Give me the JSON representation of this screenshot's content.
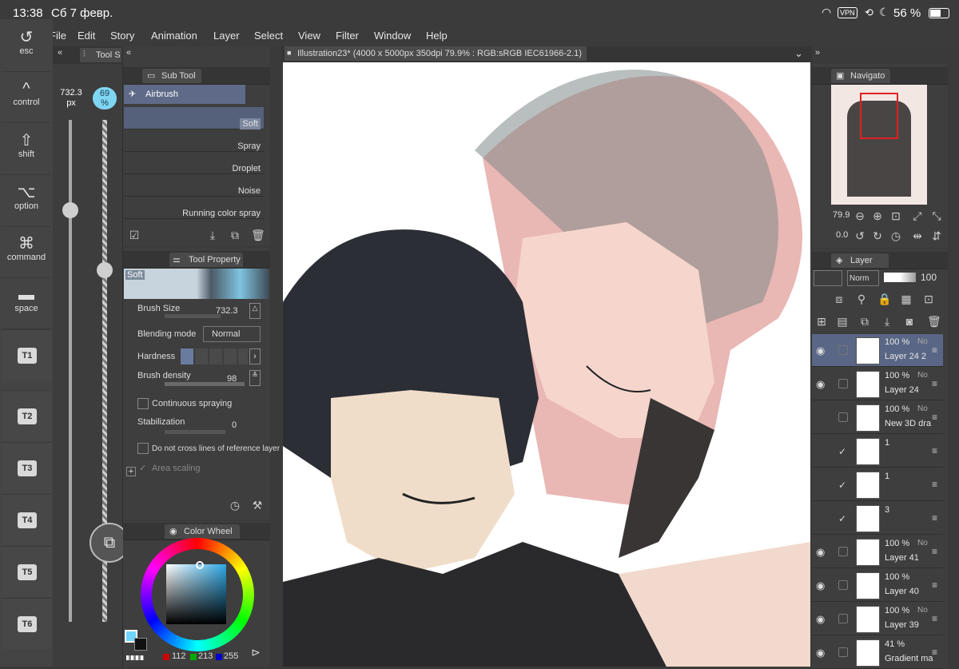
{
  "status": {
    "time": "13:38",
    "date": "Сб 7 февр.",
    "vpn": "VPN",
    "battery": "56 %"
  },
  "menu": [
    "File",
    "Edit",
    "Story",
    "Animation",
    "Layer",
    "Select",
    "View",
    "Filter",
    "Window",
    "Help"
  ],
  "edge_keys": {
    "esc": "esc",
    "control": "control",
    "shift": "shift",
    "option": "option",
    "command": "command",
    "space": "space"
  },
  "tkeys": [
    "T1",
    "T2",
    "T3",
    "T4",
    "T5",
    "T6"
  ],
  "tool_size": {
    "tab": "Tool S",
    "size": "732.3",
    "unit": "px",
    "opacity": "69",
    "opacity_unit": "%",
    "size_level": 0.18,
    "opacity_level": 0.3
  },
  "subtool": {
    "tab": "Sub Tool",
    "group": "Airbrush",
    "brushes": [
      "Soft",
      "Spray",
      "Droplet",
      "Noise",
      "Running color spray"
    ],
    "selected": "Soft"
  },
  "tool_property": {
    "tab": "Tool Property",
    "preview_label": "Soft",
    "brush_size_label": "Brush Size",
    "brush_size": "732.3",
    "blending_label": "Blending mode",
    "blending": "Normal",
    "hardness_label": "Hardness",
    "density_label": "Brush density",
    "density": "98",
    "continuous": "Continuous spraying",
    "stabilization_label": "Stabilization",
    "stabilization": "0",
    "nocross": "Do not cross lines of reference layer",
    "area_scaling": "Area scaling"
  },
  "color": {
    "tab": "Color Wheel",
    "r": "112",
    "g": "213",
    "b": "255",
    "main": "#70d5ff"
  },
  "canvas": {
    "title": "Illustration23* (4000 x 5000px 350dpi 79.9% : RGB:sRGB IEC61966-2.1)"
  },
  "navigator": {
    "tab": "Navigato",
    "zoom": "79.9",
    "rotation": "0.0"
  },
  "layer_panel": {
    "tab": "Layer",
    "blend": "Norm",
    "opacity": "100"
  },
  "layers": [
    {
      "pct": "100 %",
      "mode": "No",
      "name": "Layer 24 2",
      "selected": true,
      "visible": true
    },
    {
      "pct": "100 %",
      "mode": "No",
      "name": "Layer 24",
      "selected": false,
      "visible": true
    },
    {
      "pct": "100 %",
      "mode": "No",
      "name": "New 3D dra",
      "selected": false,
      "visible": false
    },
    {
      "pct": "1",
      "mode": "",
      "name": "",
      "selected": false,
      "visible": false,
      "checked": true
    },
    {
      "pct": "1",
      "mode": "",
      "name": "",
      "selected": false,
      "visible": false,
      "checked": true
    },
    {
      "pct": "3",
      "mode": "",
      "name": "",
      "selected": false,
      "visible": false,
      "checked": true
    },
    {
      "pct": "100 %",
      "mode": "No",
      "name": "Layer 41",
      "selected": false,
      "visible": true
    },
    {
      "pct": "100 %",
      "mode": "",
      "name": "Layer 40",
      "selected": false,
      "visible": true
    },
    {
      "pct": "100 %",
      "mode": "No",
      "name": "Layer 39",
      "selected": false,
      "visible": true
    },
    {
      "pct": "41 %",
      "mode": "",
      "name": "Gradient ma",
      "selected": false,
      "visible": true
    }
  ]
}
